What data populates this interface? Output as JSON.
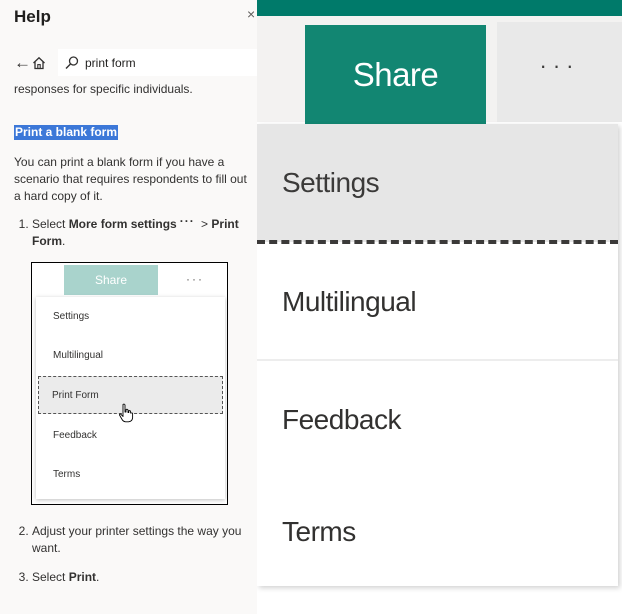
{
  "help_pane": {
    "title": "Help",
    "close_glyph": "×",
    "back_glyph": "←",
    "search_value": "print form",
    "cut_text": "responses for specific individuals.",
    "section_title": "Print a blank form",
    "intro": "You can print a blank form if you have a scenario that requires respondents to fill out a hard copy of it.",
    "step1_prefix": "Select ",
    "step1_bold": "More form settings",
    "step1_dots": "···",
    "step1_mid": " > ",
    "step1_bold2": "Print Form",
    "step1_suffix": ".",
    "step2": "Adjust your printer settings the way you want.",
    "step3_prefix": "Select ",
    "step3_bold": "Print",
    "step3_suffix": ".",
    "mini_screenshot": {
      "share_label": "Share",
      "more_glyph": "···",
      "items": [
        "Settings",
        "Multilingual",
        "Print Form",
        "Feedback",
        "Terms"
      ]
    }
  },
  "zoomed_menu": {
    "share_label": "Share",
    "more_glyph": "···",
    "items": [
      "Settings",
      "Multilingual",
      "Feedback",
      "Terms"
    ]
  },
  "colors": {
    "share_button": "#128672",
    "top_strip": "#007a6a",
    "mini_share_button": "#a9d3cc",
    "selection_highlight": "#3c78d8"
  },
  "icons": [
    "back-arrow-icon",
    "home-icon",
    "search-icon",
    "close-icon",
    "more-dots-icon",
    "hand-cursor-icon"
  ]
}
